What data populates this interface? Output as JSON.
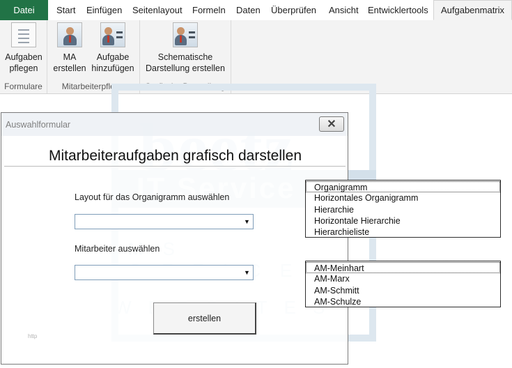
{
  "ribbon": {
    "file_tab": "Datei",
    "tabs": [
      "Start",
      "Einfügen",
      "Seitenlayout",
      "Formeln",
      "Daten",
      "Überprüfen",
      "Ansicht",
      "Entwicklertools"
    ],
    "active_tab": "Aufgabenmatrix",
    "groups": {
      "formulare": {
        "label": "Formulare",
        "button_line1": "Aufgaben",
        "button_line2": "pflegen"
      },
      "mitarbeiterpflege": {
        "label": "Mitarbeiterpflege",
        "ma_line1": "MA",
        "ma_line2": "erstellen",
        "aufgabe_line1": "Aufgabe",
        "aufgabe_line2": "hinzufügen"
      },
      "grafische": {
        "label": "Grafische Darstellung",
        "button_line1": "Schematische",
        "button_line2": "Darstellung erstellen"
      }
    }
  },
  "watermark": {
    "brand": "beetz",
    "line1": "IT Service",
    "line2": "MS OFFICE",
    "line3": "WEBSITES"
  },
  "dialog": {
    "title": "Auswahlformular",
    "close_glyph": "✕",
    "heading": "Mitarbeiteraufgaben grafisch darstellen",
    "layout_label": "Layout für das Organigramm auswählen",
    "employee_label": "Mitarbeiter auswählen",
    "combo_arrow": "▼",
    "create_button": "erstellen",
    "footer": "http"
  },
  "layout_options": [
    "Organigramm",
    "Horizontales Organigramm",
    "Hierarchie",
    "Horizontale Hierarchie",
    "Hierarchieliste"
  ],
  "employee_options": [
    "AM-Meinhart",
    "AM-Marx",
    "AM-Schmitt",
    "AM-Schulze"
  ]
}
